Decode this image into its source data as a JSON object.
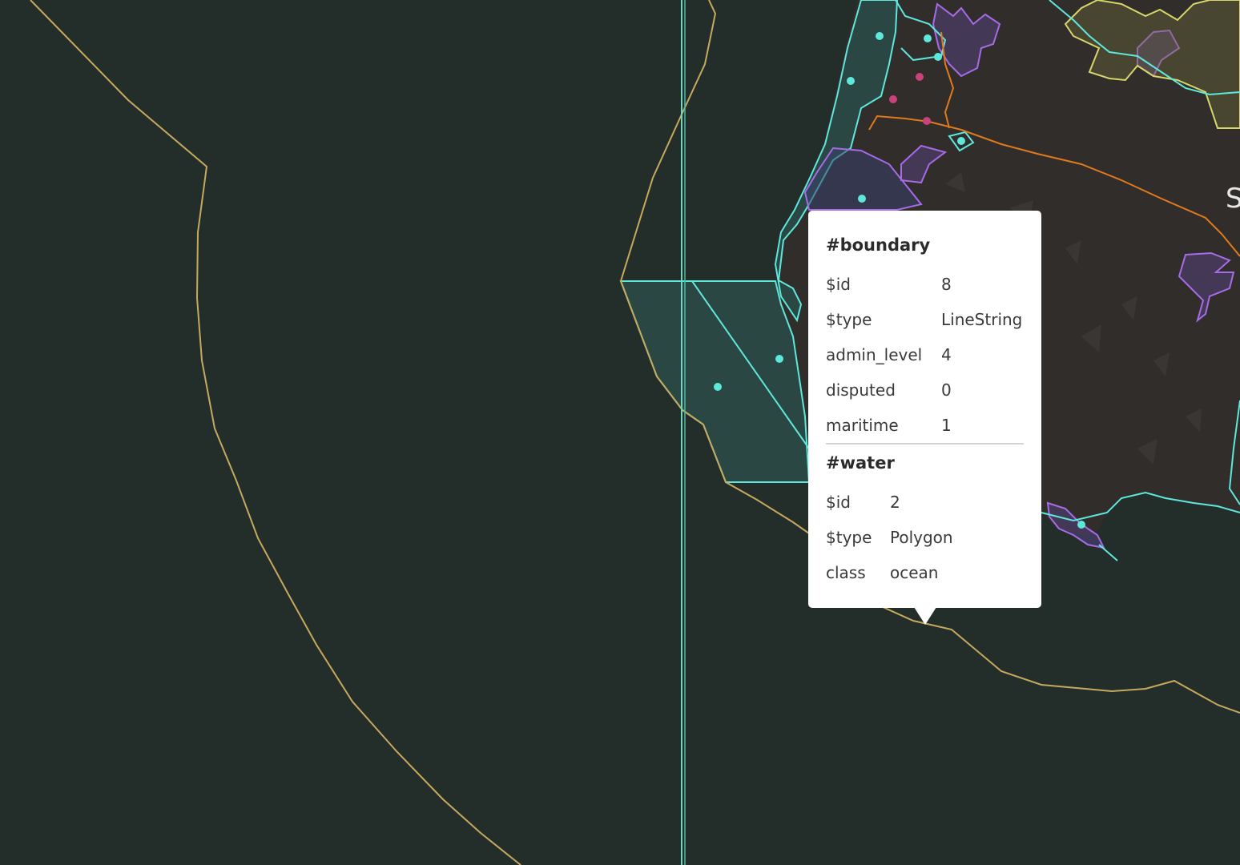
{
  "map": {
    "place_label": "S",
    "colors": {
      "background": "#232e2b",
      "land": "#312e2c",
      "water_fill": "#2b4744",
      "boundary_yellow": "#c7a95e",
      "outline_cyan": "#5ee8dc",
      "outline_purple": "#a86be8",
      "road_orange": "#e07a1c",
      "poi_pink": "#c8427c",
      "admin_yellow": "#d8d66a"
    }
  },
  "popup": {
    "layers": [
      {
        "name": "#boundary",
        "properties": [
          {
            "key": "$id",
            "value": "8"
          },
          {
            "key": "$type",
            "value": "LineString"
          },
          {
            "key": "admin_level",
            "value": "4"
          },
          {
            "key": "disputed",
            "value": "0"
          },
          {
            "key": "maritime",
            "value": "1"
          }
        ]
      },
      {
        "name": "#water",
        "properties": [
          {
            "key": "$id",
            "value": "2"
          },
          {
            "key": "$type",
            "value": "Polygon"
          },
          {
            "key": "class",
            "value": "ocean"
          }
        ]
      }
    ]
  }
}
